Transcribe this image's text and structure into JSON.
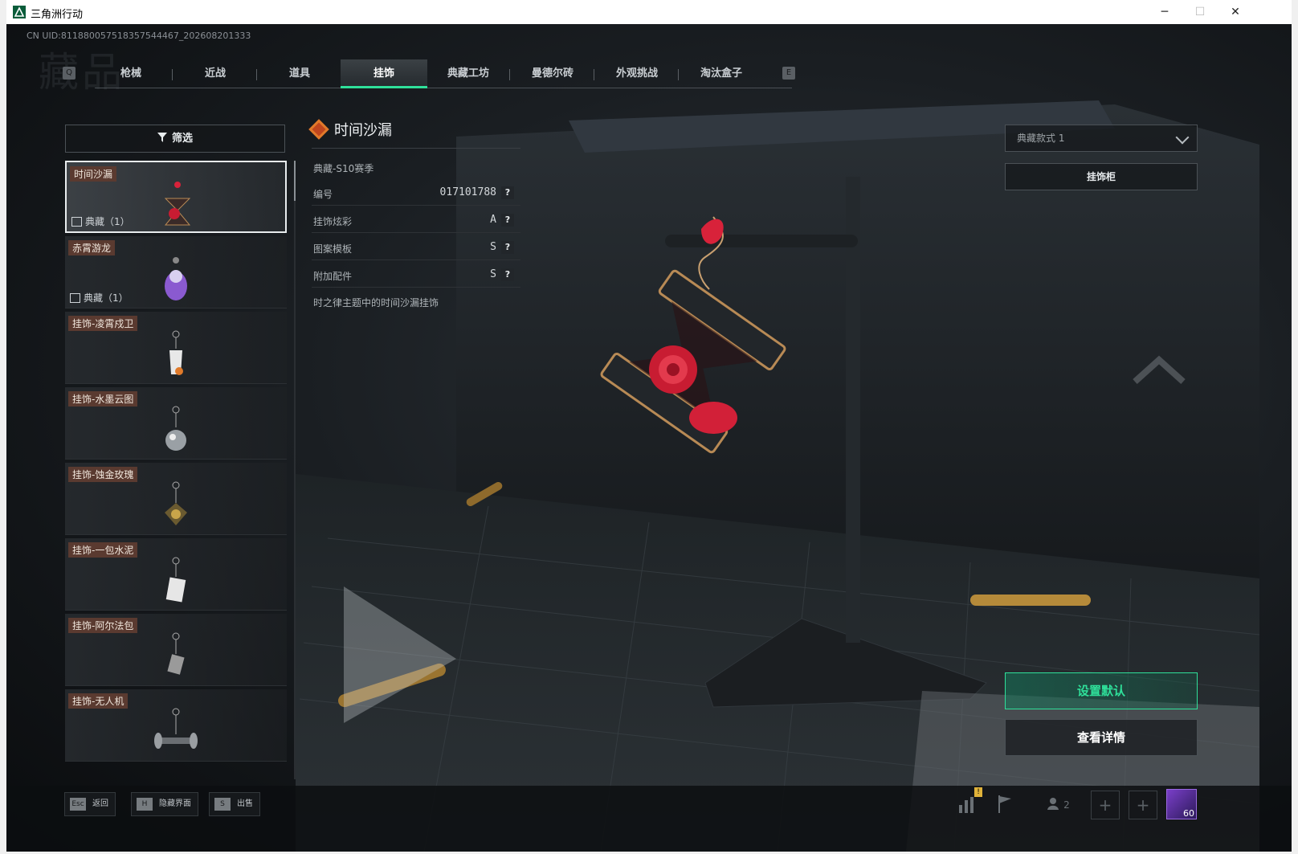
{
  "window": {
    "title": "三角洲行动",
    "controls": {
      "minimize": "─",
      "maximize": "☐",
      "close": "✕"
    }
  },
  "uid_text": "CN UID:811880057518357544467_202608201333",
  "watermark": "藏品",
  "tabs": {
    "prev_key": "Q",
    "next_key": "E",
    "items": [
      {
        "label": "枪械"
      },
      {
        "label": "近战"
      },
      {
        "label": "道具"
      },
      {
        "label": "挂饰",
        "selected": true
      },
      {
        "label": "典藏工坊"
      },
      {
        "label": "曼德尔砖"
      },
      {
        "label": "外观挑战"
      },
      {
        "label": "淘汰盒子"
      }
    ]
  },
  "filter_label": "筛选",
  "items": [
    {
      "name": "时间沙漏",
      "count": "典藏（1）",
      "icon": "hourglass-rose-charm"
    },
    {
      "name": "赤霄游龙",
      "count": "典藏（1）",
      "icon": "dragon-charm"
    },
    {
      "name": "挂饰-凌霄戍卫",
      "count": "",
      "icon": "guardian-charm"
    },
    {
      "name": "挂饰-水墨云图",
      "count": "",
      "icon": "ink-ball-charm"
    },
    {
      "name": "挂饰-蚀金玫瑰",
      "count": "",
      "icon": "gold-rose-charm"
    },
    {
      "name": "挂饰-一包水泥",
      "count": "",
      "icon": "cement-bag-charm"
    },
    {
      "name": "挂饰-阿尔法包",
      "count": "",
      "icon": "alpha-bag-charm"
    },
    {
      "name": "挂饰-无人机",
      "count": "",
      "icon": "drone-charm"
    }
  ],
  "detail": {
    "name": "时间沙漏",
    "season": "典藏-S10赛季",
    "rows": [
      {
        "label": "编号",
        "value": "017101788"
      },
      {
        "label": "挂饰炫彩",
        "value": "A"
      },
      {
        "label": "图案模板",
        "value": "S"
      },
      {
        "label": "附加配件",
        "value": "S"
      }
    ],
    "help": "?",
    "description": "时之律主题中的时间沙漏挂饰"
  },
  "style_select": {
    "value": "典藏款式 1"
  },
  "cabinet_label": "挂饰柜",
  "set_default_label": "设置默认",
  "view_details_label": "查看详情",
  "bottom": {
    "hotkeys": [
      {
        "key": "Esc",
        "label": "返回"
      },
      {
        "key": "H",
        "label": "隐藏界面"
      },
      {
        "key": "S",
        "label": "出售"
      }
    ],
    "icons": [
      "stats-icon",
      "flag-icon",
      "friends-icon"
    ],
    "friends_count": "2",
    "warning": "!",
    "plus": "+",
    "level": "60"
  },
  "colors": {
    "accent": "#2fe09a",
    "name_tag": "#5a3a30"
  }
}
